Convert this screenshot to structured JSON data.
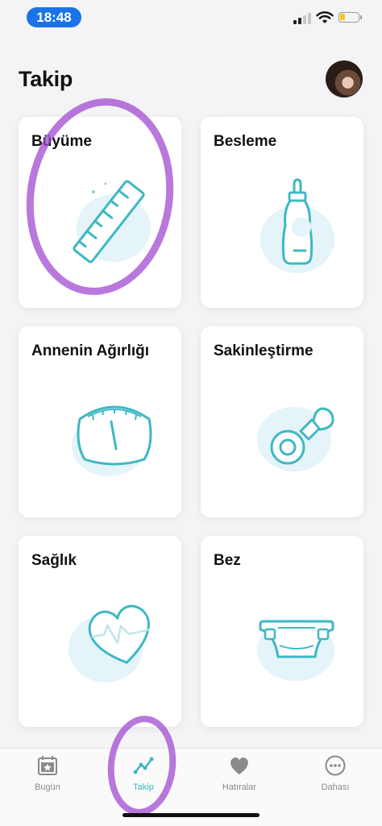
{
  "status_bar": {
    "time": "18:48",
    "time_pill_color": "#1a73e8",
    "battery_color": "#f5c518",
    "icons": [
      "signal-icon",
      "wifi-icon",
      "battery-icon"
    ]
  },
  "header": {
    "title": "Takip",
    "avatar_icon": "profile-photo"
  },
  "cards": [
    {
      "title": "Büyüme",
      "icon": "ruler-icon"
    },
    {
      "title": "Besleme",
      "icon": "baby-bottle-icon"
    },
    {
      "title": "Annenin Ağırlığı",
      "icon": "scale-icon"
    },
    {
      "title": "Sakinleştirme",
      "icon": "pacifier-icon"
    },
    {
      "title": "Sağlık",
      "icon": "heart-pulse-icon"
    },
    {
      "title": "Bez",
      "icon": "diaper-icon"
    }
  ],
  "tab_bar": {
    "tabs": [
      {
        "label": "Bugün",
        "icon": "calendar-star-icon",
        "active": false
      },
      {
        "label": "Takip",
        "icon": "trend-line-icon",
        "active": true
      },
      {
        "label": "Hatıralar",
        "icon": "heart-icon",
        "active": false
      },
      {
        "label": "Dahası",
        "icon": "more-dots-icon",
        "active": false
      }
    ]
  },
  "colors": {
    "accent": "#3db8c3",
    "icon_blob": "#e4f4f8",
    "annotation": "#a24bd0",
    "inactive_tab": "#8a8a8a"
  }
}
